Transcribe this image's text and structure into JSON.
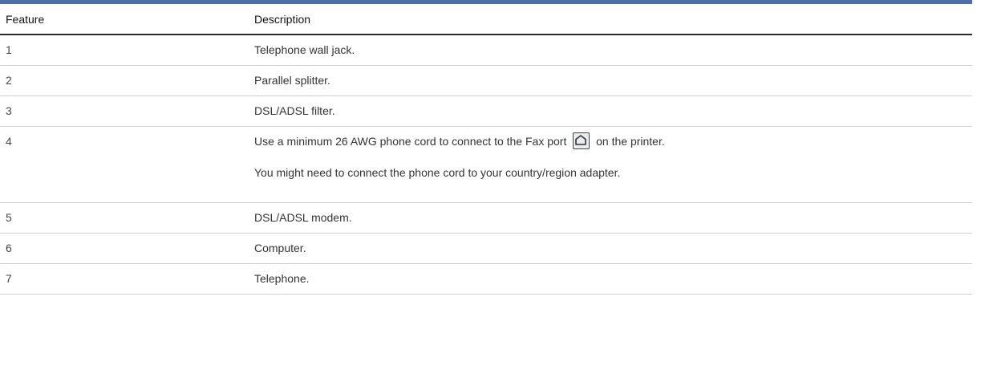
{
  "table": {
    "headers": {
      "feature": "Feature",
      "description": "Description"
    },
    "rows": [
      {
        "feature": "1",
        "description": "Telephone wall jack."
      },
      {
        "feature": "2",
        "description": "Parallel splitter."
      },
      {
        "feature": "3",
        "description": "DSL/ADSL filter."
      },
      {
        "feature": "4",
        "description_before_icon": "Use a minimum 26 AWG phone cord to connect to the Fax port",
        "icon": "fax-port-icon",
        "description_after_icon": "on the printer.",
        "description_note": "You might need to connect the phone cord to your country/region adapter."
      },
      {
        "feature": "5",
        "description": "DSL/ADSL modem."
      },
      {
        "feature": "6",
        "description": "Computer."
      },
      {
        "feature": "7",
        "description": "Telephone."
      }
    ]
  },
  "colors": {
    "accent_rule": "#4f6da8",
    "header_rule": "#2b2b2b",
    "row_rule": "#cfcfcf"
  }
}
